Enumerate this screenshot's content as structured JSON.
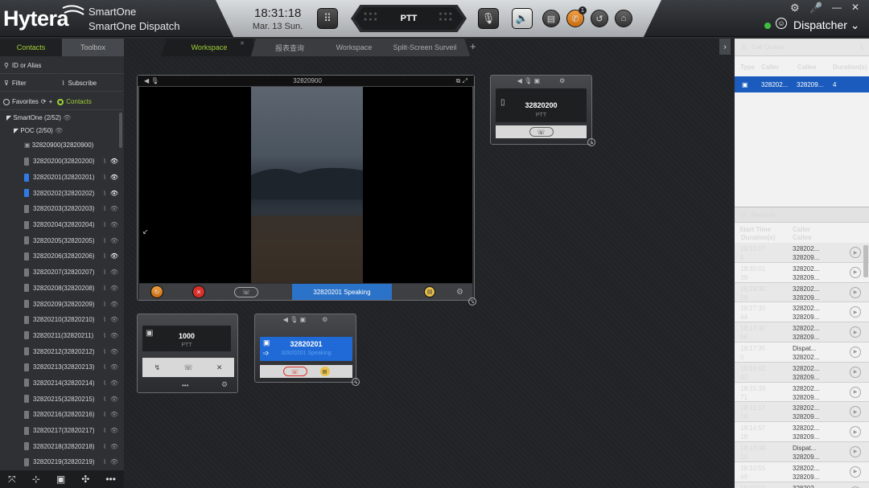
{
  "header": {
    "logo": "Hytera",
    "app_name_1": "SmartOne",
    "app_name_2": "SmartOne Dispatch",
    "time": "18:31:18",
    "date": "Mar. 13 Sun.",
    "ptt_label": "PTT",
    "notify_badge": "1",
    "user": "Dispatcher",
    "minimize": "—",
    "close": "✕"
  },
  "left": {
    "tab_contacts": "Contacts",
    "tab_toolbox": "Toolbox",
    "search_placeholder": "ID or Alias",
    "filter": "Filter",
    "subscribe": "Subscribe",
    "favorites": "Favorites",
    "contacts": "Contacts",
    "tree_root": "SmartOne (2/52)",
    "tree_group": "POC (2/50)",
    "group_item": "32820900(32820900)",
    "items": [
      {
        "label": "32820200(32820200)",
        "on": false,
        "eye_on": true
      },
      {
        "label": "32820201(32820201)",
        "on": true,
        "eye_on": true
      },
      {
        "label": "32820202(32820202)",
        "on": true,
        "eye_on": true
      },
      {
        "label": "32820203(32820203)",
        "on": false,
        "eye_on": false
      },
      {
        "label": "32820204(32820204)",
        "on": false,
        "eye_on": false
      },
      {
        "label": "32820205(32820205)",
        "on": false,
        "eye_on": false
      },
      {
        "label": "32820206(32820206)",
        "on": false,
        "eye_on": true
      },
      {
        "label": "32820207(32820207)",
        "on": false,
        "eye_on": false
      },
      {
        "label": "32820208(32820208)",
        "on": false,
        "eye_on": false
      },
      {
        "label": "32820209(32820209)",
        "on": false,
        "eye_on": false
      },
      {
        "label": "32820210(32820210)",
        "on": false,
        "eye_on": false
      },
      {
        "label": "32820211(32820211)",
        "on": false,
        "eye_on": false
      },
      {
        "label": "32820212(32820212)",
        "on": false,
        "eye_on": false
      },
      {
        "label": "32820213(32820213)",
        "on": false,
        "eye_on": false
      },
      {
        "label": "32820214(32820214)",
        "on": false,
        "eye_on": false
      },
      {
        "label": "32820215(32820215)",
        "on": false,
        "eye_on": false
      },
      {
        "label": "32820216(32820216)",
        "on": false,
        "eye_on": false
      },
      {
        "label": "32820217(32820217)",
        "on": false,
        "eye_on": false
      },
      {
        "label": "32820218(32820218)",
        "on": false,
        "eye_on": false
      },
      {
        "label": "32820219(32820219)",
        "on": false,
        "eye_on": false
      }
    ]
  },
  "workspace": {
    "tabs": [
      "Workspace",
      "报表查询",
      "Workspace",
      "Split-Screen Surveil"
    ],
    "add_tab": "+",
    "video_title": "32820900",
    "video_status": "32820201 Speaking",
    "call1_id": "32820200",
    "call1_mode": "PTT",
    "call2_id": "1000",
    "call2_mode": "PTT",
    "call2_more": "•••",
    "call3_id": "32820201",
    "call3_status": "32820201 Speaking"
  },
  "call_queue": {
    "title": "Call Queue",
    "count": "1",
    "columns": [
      "Type",
      "Caller",
      "Callee",
      "Duration(s)"
    ],
    "row": {
      "caller": "328202...",
      "callee": "328209...",
      "duration": "4"
    }
  },
  "recents": {
    "title": "Recents",
    "col1a": "Start Time",
    "col1b": "Duration(s)",
    "col2a": "Caller",
    "col2b": "Callee",
    "rows": [
      {
        "time": "18:31:07",
        "dur": "5",
        "caller": "328202...",
        "callee": "328209..."
      },
      {
        "time": "18:30:01",
        "dur": "39",
        "caller": "328202...",
        "callee": "328209..."
      },
      {
        "time": "18:29:30",
        "dur": "29",
        "caller": "328202...",
        "callee": "328209..."
      },
      {
        "time": "18:27:30",
        "dur": "44",
        "caller": "328202...",
        "callee": "328209..."
      },
      {
        "time": "18:17:40",
        "dur": "56",
        "caller": "328202...",
        "callee": "328209..."
      },
      {
        "time": "18:17:35",
        "dur": "0",
        "caller": "Dispat...",
        "callee": "328202..."
      },
      {
        "time": "18:16:52",
        "dur": "42",
        "caller": "328202...",
        "callee": "328209..."
      },
      {
        "time": "18:15:39",
        "dur": "71",
        "caller": "328202...",
        "callee": "328209..."
      },
      {
        "time": "18:15:17",
        "dur": "19",
        "caller": "328202...",
        "callee": "328209..."
      },
      {
        "time": "18:14:57",
        "dur": "18",
        "caller": "328202...",
        "callee": "328209..."
      },
      {
        "time": "18:13:48",
        "dur": "10",
        "caller": "Dispat...",
        "callee": "328209..."
      },
      {
        "time": "18:10:55",
        "dur": "49",
        "caller": "328202...",
        "callee": "328209..."
      },
      {
        "time": "18:09:02",
        "dur": "",
        "caller": "328202...",
        "callee": ""
      }
    ]
  },
  "colors": {
    "accent_green": "#9fd037",
    "selection_blue": "#1a5bbd",
    "speaking_blue": "#2a73c9"
  }
}
